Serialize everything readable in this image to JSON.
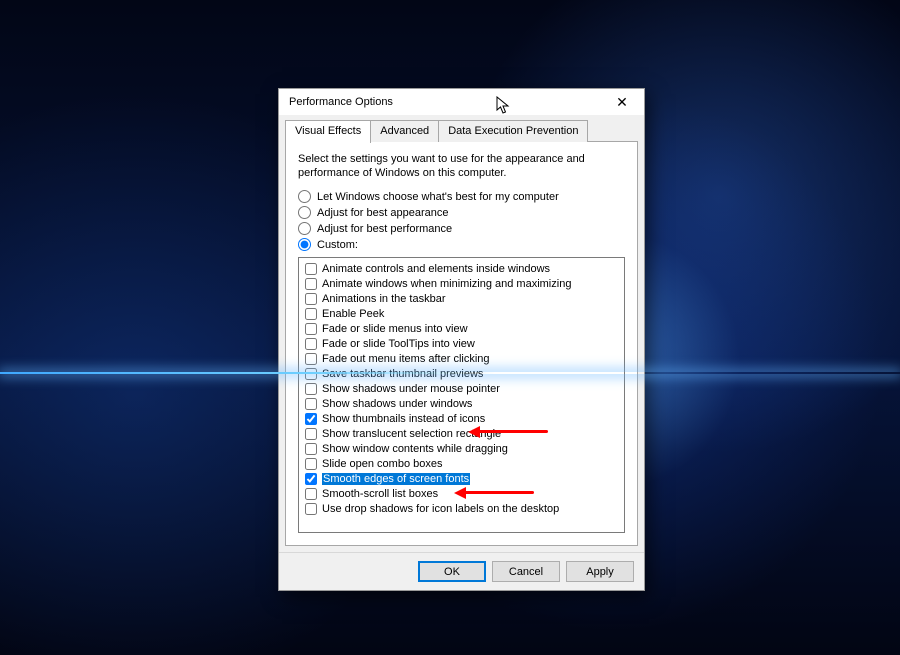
{
  "dialog": {
    "title": "Performance Options",
    "tabs": [
      "Visual Effects",
      "Advanced",
      "Data Execution Prevention"
    ],
    "active_tab": 0,
    "description": "Select the settings you want to use for the appearance and performance of Windows on this computer.",
    "radios": {
      "auto": "Let Windows choose what's best for my computer",
      "best_a": "Adjust for best appearance",
      "best_p": "Adjust for best performance",
      "custom": "Custom:"
    },
    "selected_radio": "custom",
    "options": [
      {
        "label": "Animate controls and elements inside windows",
        "checked": false
      },
      {
        "label": "Animate windows when minimizing and maximizing",
        "checked": false
      },
      {
        "label": "Animations in the taskbar",
        "checked": false
      },
      {
        "label": "Enable Peek",
        "checked": false
      },
      {
        "label": "Fade or slide menus into view",
        "checked": false
      },
      {
        "label": "Fade or slide ToolTips into view",
        "checked": false
      },
      {
        "label": "Fade out menu items after clicking",
        "checked": false
      },
      {
        "label": "Save taskbar thumbnail previews",
        "checked": false
      },
      {
        "label": "Show shadows under mouse pointer",
        "checked": false
      },
      {
        "label": "Show shadows under windows",
        "checked": false
      },
      {
        "label": "Show thumbnails instead of icons",
        "checked": true,
        "annotated": true
      },
      {
        "label": "Show translucent selection rectangle",
        "checked": false
      },
      {
        "label": "Show window contents while dragging",
        "checked": false
      },
      {
        "label": "Slide open combo boxes",
        "checked": false
      },
      {
        "label": "Smooth edges of screen fonts",
        "checked": true,
        "selected": true,
        "annotated": true
      },
      {
        "label": "Smooth-scroll list boxes",
        "checked": false
      },
      {
        "label": "Use drop shadows for icon labels on the desktop",
        "checked": false
      }
    ],
    "buttons": {
      "ok": "OK",
      "cancel": "Cancel",
      "apply": "Apply"
    }
  }
}
